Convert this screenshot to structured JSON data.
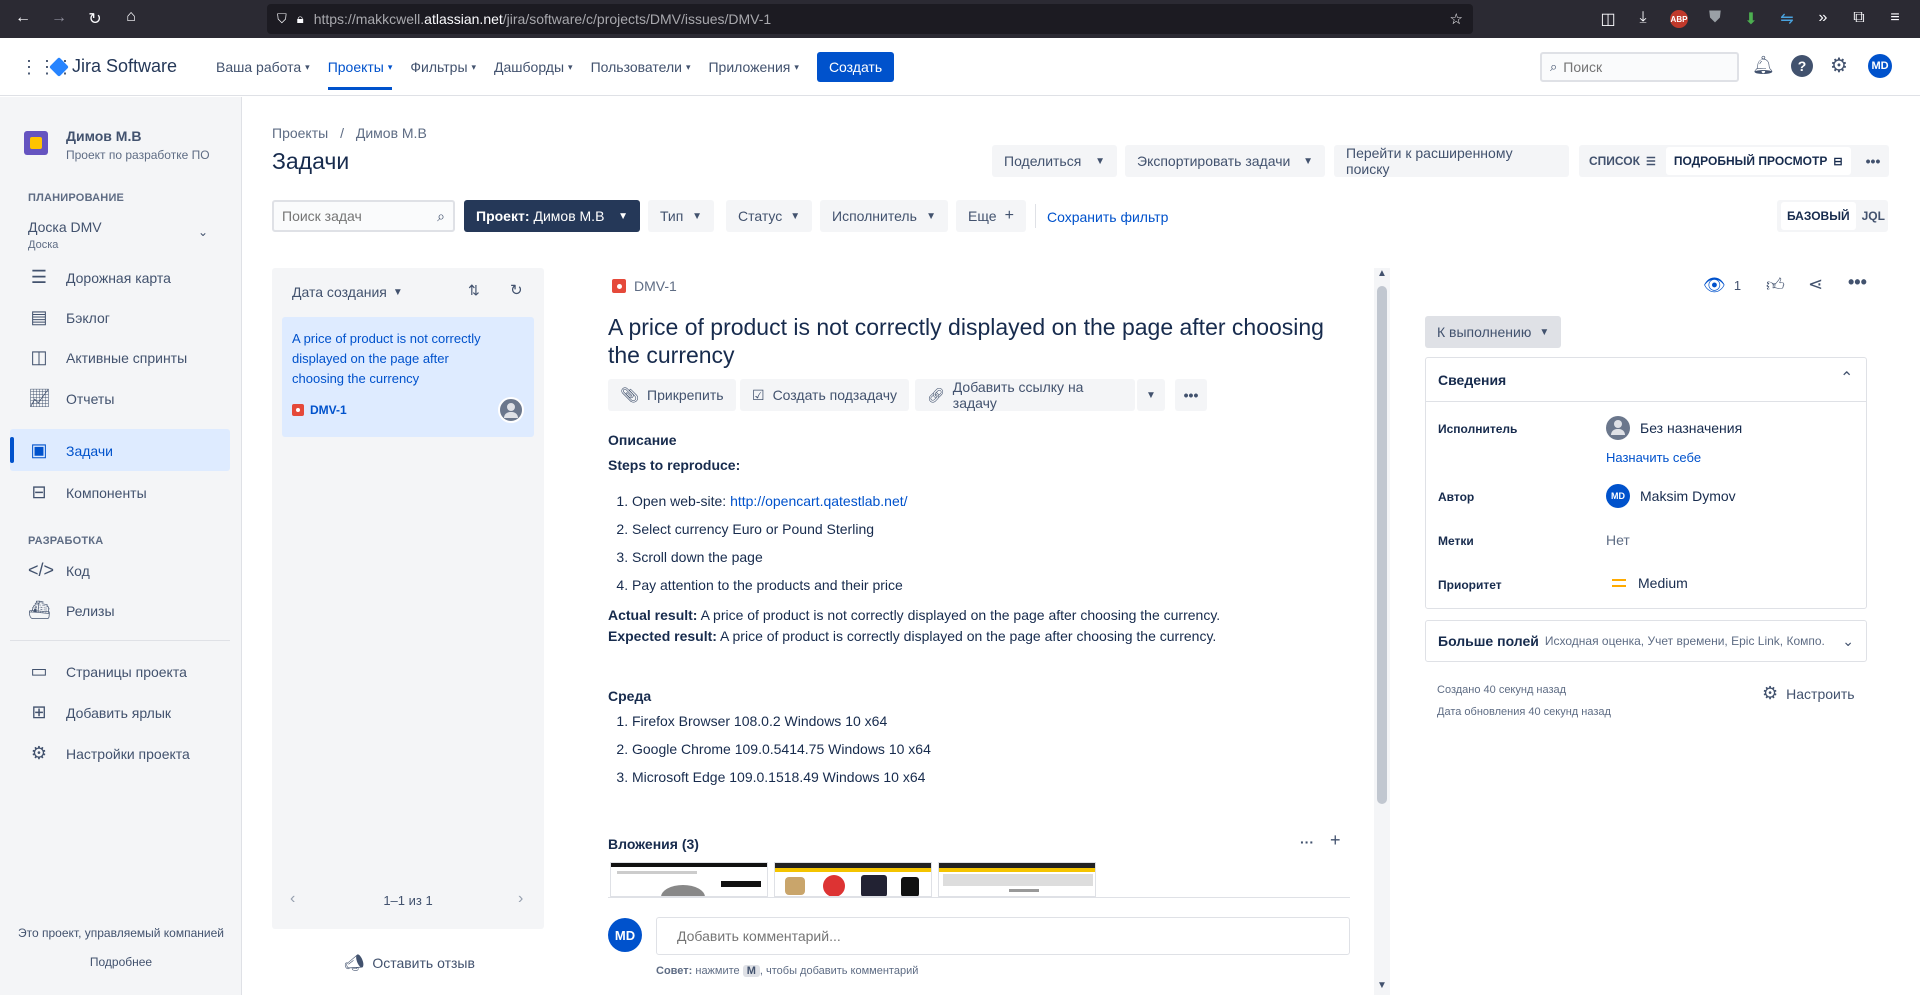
{
  "browser": {
    "url_prefix": "https://makkcwell.",
    "url_domain": "atlassian.net",
    "url_path": "/jira/software/c/projects/DMV/issues/DMV-1"
  },
  "topnav": {
    "product": "Jira Software",
    "items": [
      "Ваша работа",
      "Проекты",
      "Фильтры",
      "Дашборды",
      "Пользователи",
      "Приложения"
    ],
    "create": "Создать",
    "search_placeholder": "Поиск",
    "user_initials": "MD"
  },
  "sidebar": {
    "project_name": "Димов М.В",
    "project_type": "Проект по разработке ПО",
    "planning_header": "ПЛАНИРОВАНИЕ",
    "board_name": "Доска DMV",
    "board_type": "Доска",
    "items": [
      "Дорожная карта",
      "Бэклог",
      "Активные спринты",
      "Отчеты",
      "Задачи",
      "Компоненты"
    ],
    "dev_header": "РАЗРАБОТКА",
    "dev_items": [
      "Код",
      "Релизы"
    ],
    "bottom_items": [
      "Страницы проекта",
      "Добавить ярлык",
      "Настройки проекта"
    ],
    "footer_text": "Это проект, управляемый компанией",
    "footer_link": "Подробнее"
  },
  "page": {
    "breadcrumb_1": "Проекты",
    "breadcrumb_2": "Димов М.В",
    "title": "Задачи",
    "actions": {
      "share": "Поделиться",
      "export": "Экспортировать задачи",
      "advanced": "Перейти к расширенному поиску",
      "list": "СПИСОК",
      "detail": "ПОДРОБНЫЙ ПРОСМОТР"
    },
    "filters": {
      "search_placeholder": "Поиск задач",
      "project_label": "Проект:",
      "project_value": "Димов М.В",
      "type": "Тип",
      "status": "Статус",
      "assignee": "Исполнитель",
      "more": "Еще",
      "save": "Сохранить фильтр",
      "basic": "БАЗОВЫЙ",
      "jql": "JQL"
    }
  },
  "issue_list": {
    "sort_label": "Дата создания",
    "card_title": "A price of product is not correctly displayed on the page after choosing the currency",
    "card_key": "DMV-1",
    "pagination": "1–1 из 1",
    "feedback": "Оставить отзыв"
  },
  "issue": {
    "key": "DMV-1",
    "title": "A price of product is not correctly displayed on the page after choosing the currency",
    "attach": "Прикрепить",
    "subtask": "Создать подзадачу",
    "link": "Добавить ссылку на задачу",
    "description_label": "Описание",
    "steps_label": "Steps to reproduce:",
    "step1_text": "Open web-site: ",
    "step1_link": "http://opencart.qatestlab.net/",
    "step2": "Select currency Euro or Pound Sterling",
    "step3": "Scroll down the page",
    "step4": "Pay attention to the products and their price",
    "actual_label": "Actual result:",
    "actual_text": " A price of product is not correctly displayed on the page after choosing the currency.",
    "expected_label": "Expected result:",
    "expected_text": " A price of product is correctly displayed on the page after choosing the currency.",
    "env_label": "Среда",
    "env1": "Firefox Browser 108.0.2 Windows 10 x64",
    "env2": "Google Chrome 109.0.5414.75 Windows 10 x64",
    "env3": "Microsoft Edge 109.0.1518.49 Windows 10 x64",
    "attachments_label": "Вложения (3)",
    "comment_placeholder": "Добавить комментарий...",
    "tip_prefix": "Совет:",
    "tip_mid": " нажмите ",
    "tip_key": "M",
    "tip_suffix": ", чтобы добавить комментарий"
  },
  "details": {
    "watchers": "1",
    "status": "К выполнению",
    "section_title": "Сведения",
    "assignee_label": "Исполнитель",
    "assignee_value": "Без назначения",
    "assign_self": "Назначить себе",
    "reporter_label": "Автор",
    "reporter_value": "Maksim Dymov",
    "labels_label": "Метки",
    "labels_value": "Нет",
    "priority_label": "Приоритет",
    "priority_value": "Medium",
    "more_fields": "Больше полей",
    "more_fields_hint": "Исходная оценка, Учет времени, Epic Link, Компо...",
    "created": "Создано 40 секунд назад",
    "updated": "Дата обновления 40 секунд назад",
    "configure": "Настроить"
  },
  "colors": {
    "accent": "#0052cc",
    "bug": "#e5493a",
    "sidebar_bg": "#f4f5f7",
    "selected_bg": "#deebff"
  }
}
